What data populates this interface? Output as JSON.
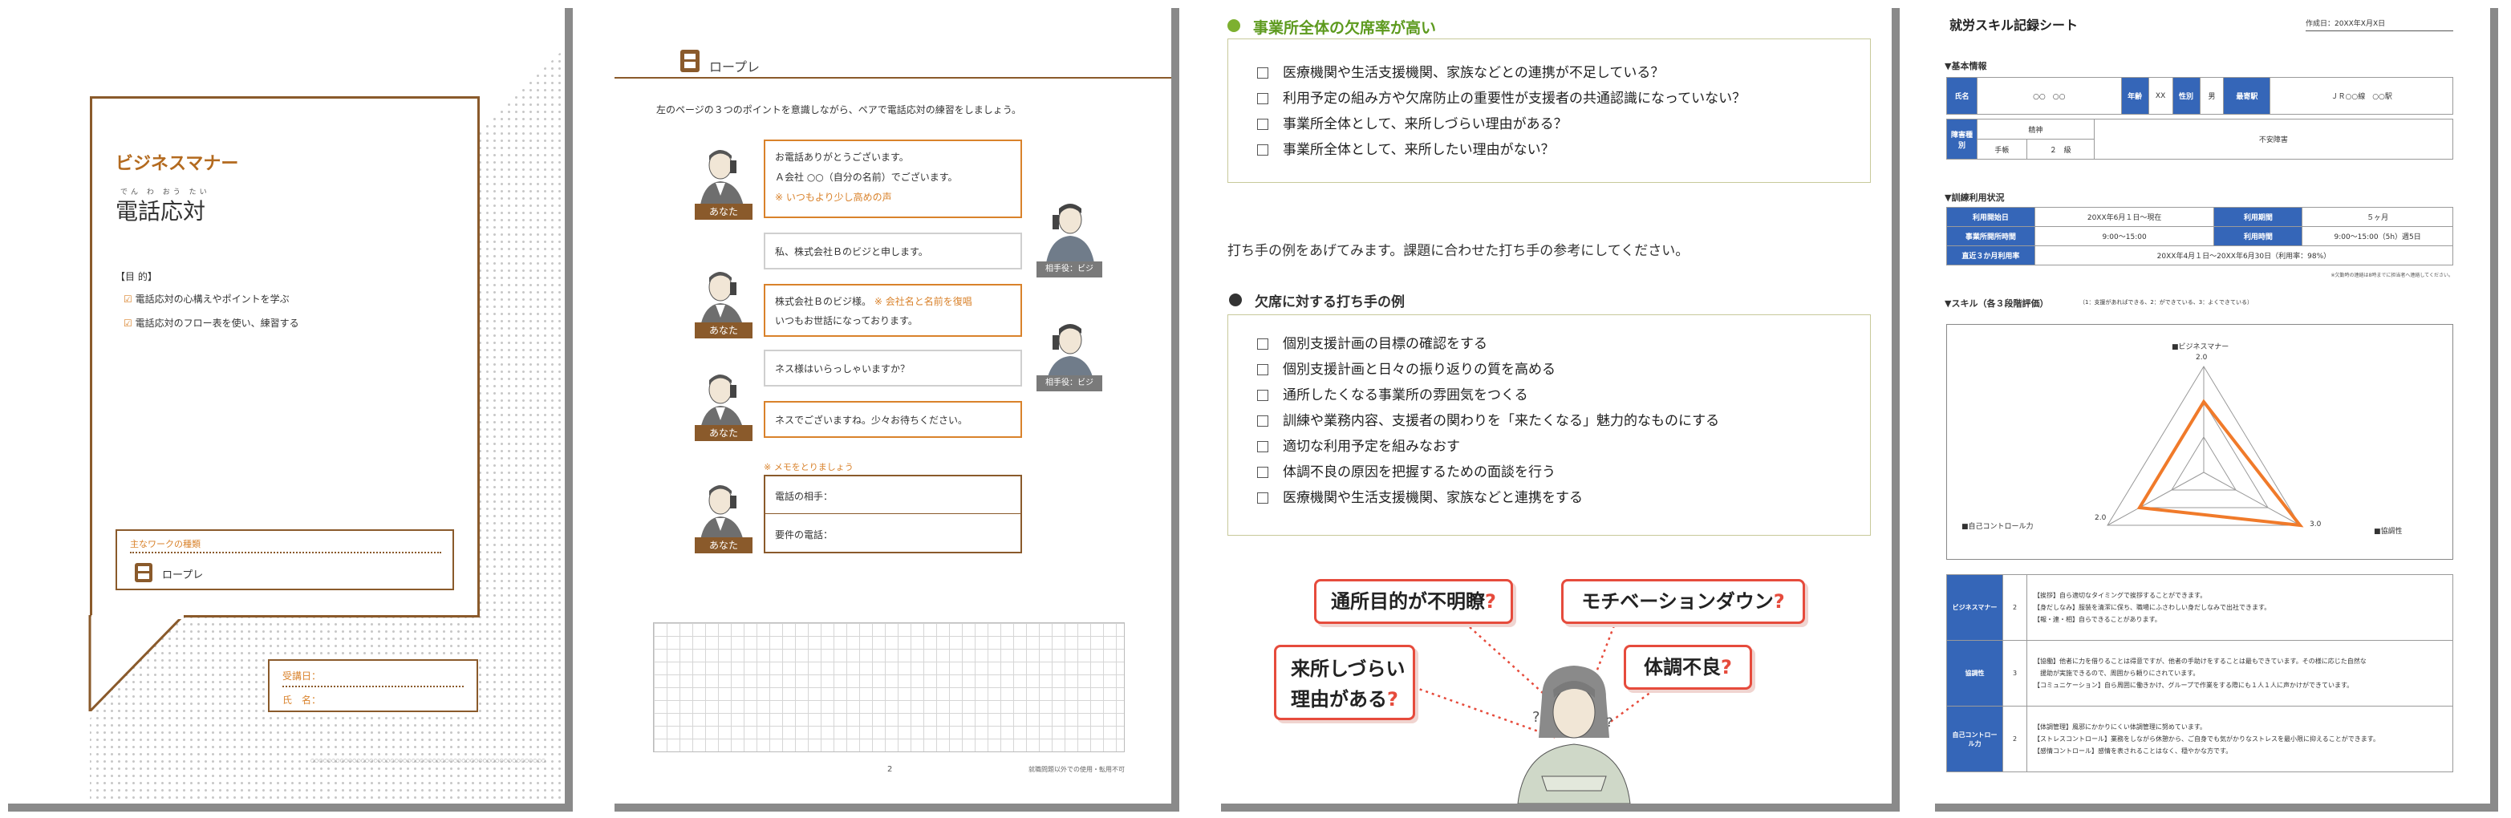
{
  "page1": {
    "title_en": "ビジネスマナー",
    "title_main": "電話応対",
    "title_ruby": "でん わ おう たい",
    "purpose_label": "【目 的】",
    "purpose_items": [
      "電話応対の心構えやポイントを学ぶ",
      "電話応対のフロー表を使い、練習する"
    ],
    "work_label": "主なワークの種類",
    "work_item": "ロープレ",
    "date_label": "受講日：",
    "name_label": "氏　名：",
    "footer_text": "○○○○○○○○○○○○○○○○○○○○○○○○○○○○○○○○○○○○○○○○○○○○○○○○○○○○○○○○"
  },
  "page2": {
    "header": "ロープレ",
    "instruction": "左のページの３つのポイントを意識しながら、ペアで電話応対の練習をしましょう。",
    "you_label": "あなた",
    "other_label": "相手役：ビジ",
    "lines": [
      {
        "text": "お電話ありがとうございます。",
        "text2": "Ａ会社 ○○（自分の名前）でございます。",
        "note": "※ いつもより少し高めの声"
      },
      {
        "text": "私、株式会社Ｂのビジと申します。"
      },
      {
        "text": "株式会社Ｂのビジ様。",
        "note_inline": "※ 会社名と名前を復唱",
        "text2": "いつもお世話になっております。"
      },
      {
        "text": "ネス様はいらっしゃいますか？"
      },
      {
        "text": "ネスでございますね。少々お待ちください。"
      }
    ],
    "memo_label": "※ メモをとりましょう",
    "memo_fields": [
      "電話の相手：",
      "要件の電話："
    ],
    "page_number": "2",
    "footer_right": "就職問題以外での使用・転用不可"
  },
  "page3": {
    "section_title": "事業所全体の欠席率が高い",
    "checklist1": [
      "医療機関や生活支援機関、家族などとの連携が不足している？",
      "利用予定の組み方や欠席防止の重要性が支援者の共通認識になっていない？",
      "事業所全体として、来所しづらい理由がある？",
      "事業所全体として、来所したい理由がない？"
    ],
    "intro_text": "打ち手の例をあげてみます。課題に合わせた打ち手の参考にしてください。",
    "section2_title": "欠席に対する打ち手の例",
    "checklist2": [
      "個別支援計画の目標の確認をする",
      "個別支援計画と日々の振り返りの質を高める",
      "通所したくなる事業所の雰囲気をつくる",
      "訓練や業務内容、支援者の関わりを「来たくなる」魅力的なものにする",
      "適切な利用予定を組みなおす",
      "体調不良の原因を把握するための面談を行う",
      "医療機関や生活支援機関、家族などと連携をする"
    ],
    "bubbles": [
      "通所目的が不明瞭",
      "モチベーションダウン",
      "来所しづらい",
      "理由がある",
      "体調不良"
    ],
    "q": "?"
  },
  "page4": {
    "title": "就労スキル記録シート",
    "created": "作成日：20XX年X月X日",
    "basic_info": "▼基本情報",
    "name_h": "氏名",
    "name_v": "○○　○○",
    "age_h": "年齢",
    "age_v": "XX",
    "sex_h": "性別",
    "sex_v": "男",
    "station_h": "最寄駅",
    "station_v": "ＪＲ○○線　○○駅",
    "disability_h": "障害種別",
    "disability_v1": "精神",
    "disability_v2": "手帳",
    "disability_v3": "２　級",
    "disability_v4": "不安障害",
    "training_title": "▼訓練利用状況",
    "start_h": "利用開始日",
    "start_v": "20XX年6月１日～現在",
    "period_h": "利用期間",
    "period_v": "５ヶ月",
    "hours_h": "事業所開所時間",
    "hours_v": "9:00～15:00",
    "usage_h": "利用時間",
    "usage_v": "9:00～15:00（5h）週5日",
    "rate_h": "直近３か月利用率",
    "rate_v": "20XX年4月１日～20XX年6月30日（利用率：98%）",
    "small_note": "※欠勤時の連絡は8時までに担当者へ連絡してください。",
    "skill_title": "▼スキル（各３段階評価）",
    "skill_note": "（1：支援があればできる、2：ができている、3：よくできている）",
    "radar_labels": [
      "■ビジネスマナー",
      "■協調性",
      "■自己コントロール力"
    ],
    "radar_axis": [
      "2.0",
      "3.0",
      "2.0"
    ],
    "skills": [
      {
        "name": "ビジネスマナー",
        "score": "2",
        "lines": [
          "【挨拶】自ら適切なタイミングで挨拶することができます。",
          "【身だしなみ】服装を清潔に保ち、職場にふさわしい身だしなみで出社できます。",
          "【報・連・相】自らできることがあります。"
        ]
      },
      {
        "name": "協調性",
        "score": "3",
        "lines": [
          "【協働】他者に力を借りることは得意ですが、他者の手助けをすることは最もできています。その様に応じた自然な",
          "　援助が実施できるので、周囲から頼りにされています。",
          "【コミュニケーション】自ら周囲に働きかけ、グループで作業をする際にも１人１人に声かけができています。"
        ]
      },
      {
        "name": "自己コントロール力",
        "score": "2",
        "lines": [
          "【体調管理】風邪にかかりにくい体調管理に努めています。",
          "【ストレスコントロール】業務をしながら休憩から、ご自身でも気がかりなストレスを最小限に抑えることができます。",
          "【感情コントロール】感情を表されることはなく、穏やかな方です。"
        ]
      }
    ]
  },
  "colors": {
    "brown": "#8a5a2b",
    "orange": "#d9822b",
    "green": "#7db030",
    "blue": "#3566b8",
    "red": "#e64b3c"
  }
}
